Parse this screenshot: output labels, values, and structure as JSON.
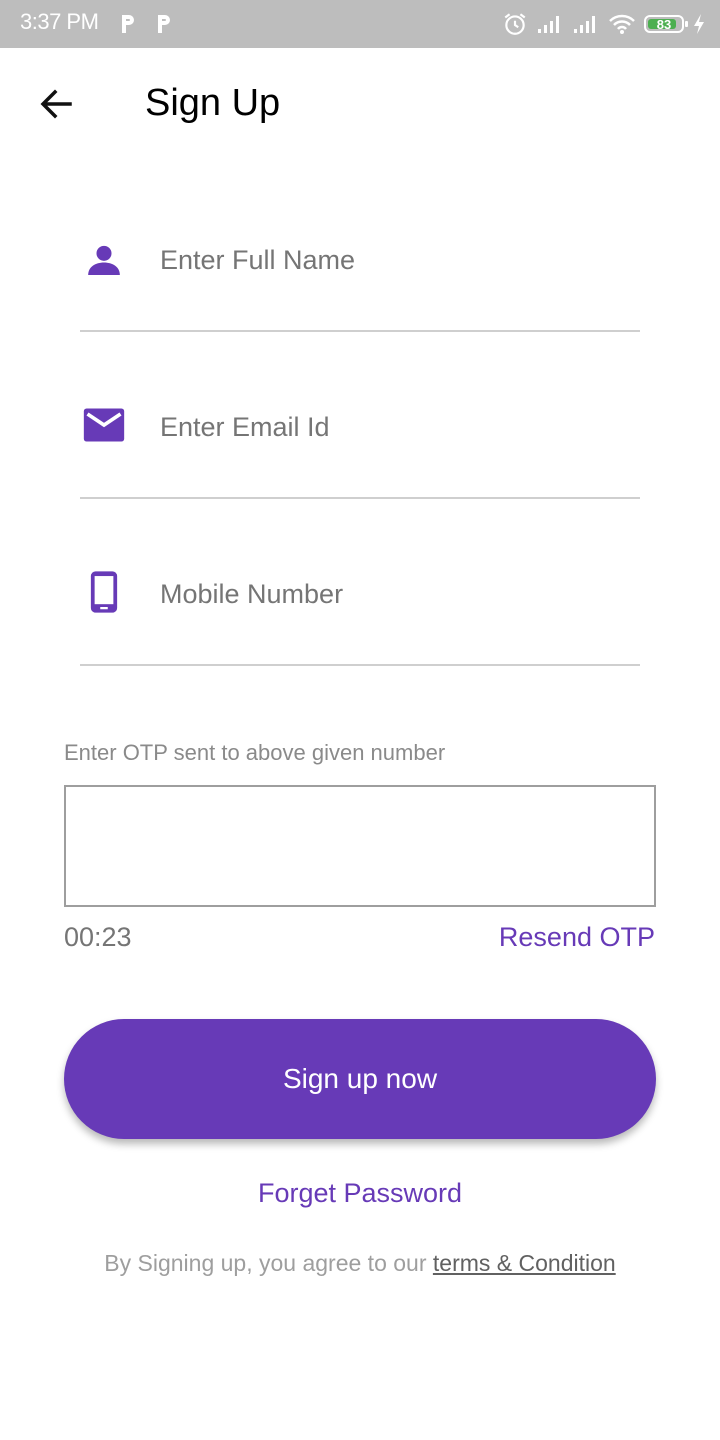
{
  "status_bar": {
    "time": "3:37 PM",
    "battery_level": "83",
    "icons": [
      "parking-icon",
      "parking-icon",
      "alarm-icon",
      "signal-icon",
      "signal-icon",
      "wifi-icon",
      "battery-icon",
      "charging-icon"
    ]
  },
  "header": {
    "title": "Sign Up",
    "back_icon": "arrow-left-icon"
  },
  "form": {
    "full_name": {
      "placeholder": "Enter Full Name",
      "value": "",
      "icon": "person-icon"
    },
    "email": {
      "placeholder": "Enter Email Id",
      "value": "",
      "icon": "mail-icon"
    },
    "mobile": {
      "placeholder": "Mobile Number",
      "value": "",
      "icon": "phone-icon"
    },
    "otp": {
      "label": "Enter OTP sent to above given number",
      "value": "",
      "timer": "00:23",
      "resend_label": "Resend OTP"
    }
  },
  "actions": {
    "signup_label": "Sign up now",
    "forget_password_label": "Forget Password"
  },
  "footer": {
    "terms_prefix": "By Signing up, you agree to our",
    "terms_link": "terms & Condition"
  },
  "colors": {
    "accent": "#673ab7",
    "status_bar": "#bdbdbd",
    "battery": "#4caf50"
  }
}
